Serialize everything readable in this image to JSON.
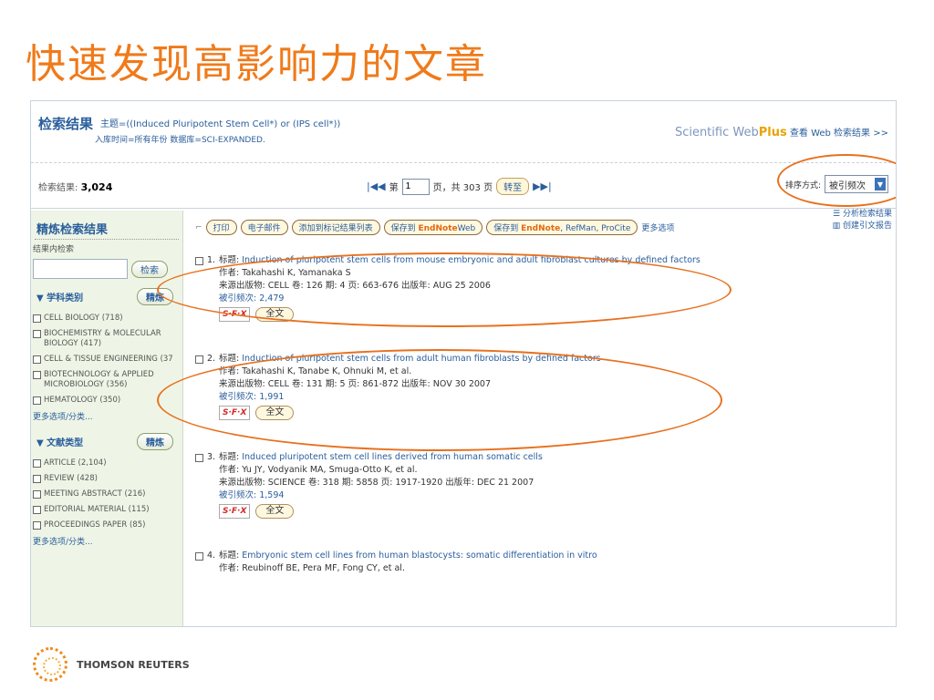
{
  "slide_title": "快速发现高影响力的文章",
  "header": {
    "title": "检索结果",
    "query": "主题=((Induced Pluripotent Stem Cell*) or (IPS cell*))",
    "sub": "入库时间=所有年份 数据库=SCI-EXPANDED.",
    "webplus_sw": "Scientific Web",
    "webplus_plus": "Plus",
    "webplus_link": "查看 Web 检索结果 >>"
  },
  "nav": {
    "count_label": "检索结果:",
    "count_value": "3,024",
    "page_prefix": "第",
    "page_value": "1",
    "page_suffix": "页，共 303 页",
    "go_label": "转至",
    "sort_label": "排序方式:",
    "sort_value": "被引频次"
  },
  "sidebar": {
    "title": "精炼检索结果",
    "within_label": "结果内检索",
    "search_button": "检索",
    "subject_heading": "学科类别",
    "refine_button": "精炼",
    "subjects": [
      "CELL BIOLOGY (718)",
      "BIOCHEMISTRY & MOLECULAR BIOLOGY (417)",
      "CELL & TISSUE ENGINEERING (37",
      "BIOTECHNOLOGY & APPLIED MICROBIOLOGY (356)",
      "HEMATOLOGY (350)"
    ],
    "more1": "更多选项/分类...",
    "doctype_heading": "文献类型",
    "doctypes": [
      "ARTICLE (2,104)",
      "REVIEW (428)",
      "MEETING ABSTRACT (216)",
      "EDITORIAL MATERIAL (115)",
      "PROCEEDINGS PAPER (85)"
    ],
    "more2": "更多选项/分类..."
  },
  "toolbar": {
    "print": "打印",
    "email": "电子邮件",
    "add_marked": "添加到标记结果列表",
    "save_en_web_pre": "保存到",
    "save_en_web_mid": "EndNote",
    "save_en_web_post": "Web",
    "save_desktop_pre": "保存到",
    "save_desktop_mid": "EndNote",
    "save_desktop_post": ", RefMan, ProCite",
    "more": "更多选项",
    "analysis": "分析检索结果",
    "citation_report": "创建引文报告"
  },
  "records": [
    {
      "num": "1.",
      "title": "Induction of pluripotent stem cells from mouse embryonic and adult fibroblast cultures by defined factors",
      "authors": "作者: Takahashi K, Yamanaka S",
      "source": "来源出版物: CELL  卷: 126  期: 4  页: 663-676  出版年: AUG 25 2006",
      "cited": "被引频次: 2,479"
    },
    {
      "num": "2.",
      "title": "Induction of pluripotent stem cells from adult human fibroblasts by defined factors",
      "authors": "作者: Takahashi K, Tanabe K, Ohnuki M, et al.",
      "source": "来源出版物: CELL  卷: 131  期: 5  页: 861-872  出版年: NOV 30 2007",
      "cited": "被引频次: 1,991"
    },
    {
      "num": "3.",
      "title": "Induced pluripotent stem cell lines derived from human somatic cells",
      "authors": "作者: Yu JY, Vodyanik MA, Smuga-Otto K, et al.",
      "source": "来源出版物: SCIENCE  卷: 318  期: 5858  页: 1917-1920  出版年: DEC 21 2007",
      "cited": "被引频次: 1,594"
    },
    {
      "num": "4.",
      "title": "Embryonic stem cell lines from human blastocysts: somatic differentiation in vitro",
      "authors": "作者: Reubinoff BE, Pera MF, Fong CY, et al.",
      "source": "",
      "cited": ""
    }
  ],
  "record_labels": {
    "title_prefix": "标题:",
    "sfx": "S·F·X",
    "fulltext": "全文"
  },
  "footer": {
    "company": "THOMSON REUTERS"
  }
}
